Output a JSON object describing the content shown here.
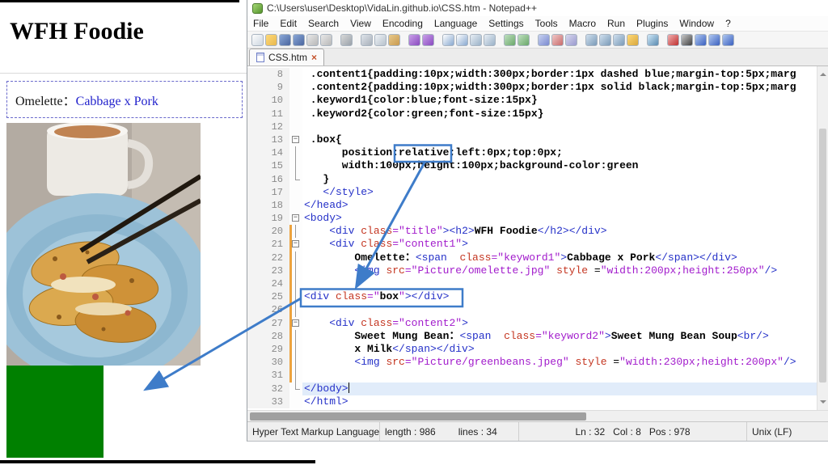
{
  "colors": {
    "annotation_blue": "#3e7cc9",
    "green_box": "#008000",
    "keyword_blue": "#2222cc"
  },
  "browser": {
    "page_title": "WFH Foodie",
    "content1": {
      "label": "Omelette：",
      "keyword": "Cabbage x Pork"
    }
  },
  "notepad": {
    "window_title": "C:\\Users\\user\\Desktop\\VidaLin.github.io\\CSS.htm - Notepad++",
    "menus": [
      "File",
      "Edit",
      "Search",
      "View",
      "Encoding",
      "Language",
      "Settings",
      "Tools",
      "Macro",
      "Run",
      "Plugins",
      "Window",
      "?"
    ],
    "toolbar_icons": [
      {
        "name": "new-file",
        "c1": "#fdfdfd",
        "c2": "#cdd6e0"
      },
      {
        "name": "open-folder",
        "c1": "#ffd978",
        "c2": "#e8b84e"
      },
      {
        "name": "save",
        "c1": "#8aa7d6",
        "c2": "#4a66a0"
      },
      {
        "name": "save-all",
        "c1": "#8aa7d6",
        "c2": "#4a66a0"
      },
      {
        "name": "close",
        "c1": "#e8e8e8",
        "c2": "#b8b8b8"
      },
      {
        "name": "close-all",
        "c1": "#e8e8e8",
        "c2": "#b8b8b8"
      },
      {
        "name": "print",
        "c1": "#d8d8d8",
        "c2": "#9aa2aa",
        "sep": true
      },
      {
        "name": "cut",
        "c1": "#dfe4ea",
        "c2": "#a8b0ba",
        "sep": true
      },
      {
        "name": "copy",
        "c1": "#eef2f6",
        "c2": "#b8c2cc"
      },
      {
        "name": "paste",
        "c1": "#e8c98a",
        "c2": "#c89a50"
      },
      {
        "name": "undo",
        "c1": "#c9a0e8",
        "c2": "#8a4ac0",
        "sep": true
      },
      {
        "name": "redo",
        "c1": "#c9a0e8",
        "c2": "#8a4ac0"
      },
      {
        "name": "find",
        "c1": "#ffffff",
        "c2": "#88a8d0",
        "sep": true
      },
      {
        "name": "replace",
        "c1": "#ffffff",
        "c2": "#88a8d0"
      },
      {
        "name": "zoom-in",
        "c1": "#e8eef4",
        "c2": "#9ab2c8"
      },
      {
        "name": "zoom-out",
        "c1": "#e8eef4",
        "c2": "#9ab2c8"
      },
      {
        "name": "sync-vertical",
        "c1": "#bfe0bf",
        "c2": "#6aa86a",
        "sep": true
      },
      {
        "name": "sync-horizontal",
        "c1": "#bfe0bf",
        "c2": "#6aa86a"
      },
      {
        "name": "word-wrap",
        "c1": "#c8d2f0",
        "c2": "#7a8ad0",
        "sep": true
      },
      {
        "name": "show-all-characters",
        "c1": "#f0c8c8",
        "c2": "#c86a6a"
      },
      {
        "name": "indent-guide",
        "c1": "#d8d8ee",
        "c2": "#9a9ace"
      },
      {
        "name": "function-list",
        "c1": "#d0e0ee",
        "c2": "#7a9ab8",
        "sep": true
      },
      {
        "name": "document-map",
        "c1": "#d0e0ee",
        "c2": "#7a9ab8"
      },
      {
        "name": "document-list",
        "c1": "#d0e0ee",
        "c2": "#7a9ab8"
      },
      {
        "name": "folder-as-workspace",
        "c1": "#ffd978",
        "c2": "#d8a83e"
      },
      {
        "name": "monitoring",
        "c1": "#cfe8f8",
        "c2": "#5a8ab0",
        "sep": true
      },
      {
        "name": "record-macro",
        "c1": "#f0b0b0",
        "c2": "#c03030",
        "sep": true
      },
      {
        "name": "stop-macro",
        "c1": "#c8c8c8",
        "c2": "#404040"
      },
      {
        "name": "play-macro",
        "c1": "#b0c8f0",
        "c2": "#3a60c0"
      },
      {
        "name": "save-macro",
        "c1": "#b0c8f0",
        "c2": "#3a60c0"
      },
      {
        "name": "run-macro-multiple",
        "c1": "#b0c8f0",
        "c2": "#3a60c0"
      }
    ],
    "tab": {
      "label": "CSS.htm",
      "close_glyph": "×"
    },
    "editor": {
      "lines": [
        {
          "num": 8,
          "tokens": [
            {
              "t": " .content1{padding:10px;width:300px;border:1px dashed blue;margin-top:5px;marg",
              "c": "css"
            }
          ]
        },
        {
          "num": 9,
          "tokens": [
            {
              "t": " .content2{padding:10px;width:300px;border:1px solid black;margin-top:5px;marg",
              "c": "css"
            }
          ]
        },
        {
          "num": 10,
          "tokens": [
            {
              "t": " .keyword1{color:blue;font-size:15px}",
              "c": "css"
            }
          ]
        },
        {
          "num": 11,
          "tokens": [
            {
              "t": " .keyword2{color:green;font-size:15px}",
              "c": "css"
            }
          ]
        },
        {
          "num": 12,
          "tokens": []
        },
        {
          "num": 13,
          "fold": "minus",
          "tokens": [
            {
              "t": " .box{",
              "c": "css"
            }
          ]
        },
        {
          "num": 14,
          "fold": "line",
          "tokens": [
            {
              "t": "      position:relative;left:0px;top:0px;",
              "c": "css"
            }
          ]
        },
        {
          "num": 15,
          "fold": "line",
          "tokens": [
            {
              "t": "      width:100px;height:100px;background-color:green",
              "c": "css"
            }
          ]
        },
        {
          "num": 16,
          "fold": "end",
          "tokens": [
            {
              "t": "   }",
              "c": "css"
            }
          ]
        },
        {
          "num": 17,
          "tokens": [
            {
              "t": "   </style>",
              "c": "tag"
            }
          ]
        },
        {
          "num": 18,
          "tokens": [
            {
              "t": "</head>",
              "c": "tag"
            }
          ]
        },
        {
          "num": 19,
          "fold": "minus",
          "tokens": [
            {
              "t": "<body>",
              "c": "tag"
            }
          ]
        },
        {
          "num": 20,
          "fold": "line",
          "chg": true,
          "tokens": [
            {
              "t": "    ",
              "c": "pln"
            },
            {
              "t": "<div ",
              "c": "tag"
            },
            {
              "t": "class",
              "c": "attr"
            },
            {
              "t": "=\"title\"",
              "c": "val"
            },
            {
              "t": "><h2>",
              "c": "tag"
            },
            {
              "t": "WFH Foodie",
              "c": "txt"
            },
            {
              "t": "</h2></div>",
              "c": "tag"
            }
          ]
        },
        {
          "num": 21,
          "fold": "minus",
          "chg": true,
          "tokens": [
            {
              "t": "    ",
              "c": "pln"
            },
            {
              "t": "<div ",
              "c": "tag"
            },
            {
              "t": "class",
              "c": "attr"
            },
            {
              "t": "=\"content1\"",
              "c": "val"
            },
            {
              "t": ">",
              "c": "tag"
            }
          ]
        },
        {
          "num": 22,
          "fold": "line",
          "chg": true,
          "tokens": [
            {
              "t": "        ",
              "c": "pln"
            },
            {
              "t": "Omelette：",
              "c": "txt"
            },
            {
              "t": "<span ",
              "c": "tag"
            },
            {
              "t": " class",
              "c": "attr"
            },
            {
              "t": "=\"keyword1\"",
              "c": "val"
            },
            {
              "t": ">",
              "c": "tag"
            },
            {
              "t": "Cabbage x Pork",
              "c": "txt"
            },
            {
              "t": "</span></div>",
              "c": "tag"
            }
          ]
        },
        {
          "num": 23,
          "fold": "line",
          "chg": true,
          "tokens": [
            {
              "t": "        ",
              "c": "pln"
            },
            {
              "t": "<img ",
              "c": "tag"
            },
            {
              "t": "src",
              "c": "attr"
            },
            {
              "t": "=\"Picture/omelette.jpg\"",
              "c": "val"
            },
            {
              "t": " style ",
              "c": "attr"
            },
            {
              "t": "=",
              "c": "pln"
            },
            {
              "t": "\"width:200px;height:250px\"",
              "c": "val"
            },
            {
              "t": "/>",
              "c": "tag"
            }
          ]
        },
        {
          "num": 24,
          "fold": "line",
          "chg": true,
          "tokens": []
        },
        {
          "num": 25,
          "fold": "line",
          "chg": true,
          "tokens": [
            {
              "t": "<div ",
              "c": "tag"
            },
            {
              "t": "class",
              "c": "attr"
            },
            {
              "t": "=\"",
              "c": "val"
            },
            {
              "t": "box",
              "c": "txt"
            },
            {
              "t": "\"",
              "c": "val"
            },
            {
              "t": "></div>",
              "c": "tag"
            }
          ]
        },
        {
          "num": 26,
          "fold": "line",
          "chg": true,
          "tokens": []
        },
        {
          "num": 27,
          "fold": "minus",
          "chg": true,
          "tokens": [
            {
              "t": "    ",
              "c": "pln"
            },
            {
              "t": "<div ",
              "c": "tag"
            },
            {
              "t": "class",
              "c": "attr"
            },
            {
              "t": "=\"content2\"",
              "c": "val"
            },
            {
              "t": ">",
              "c": "tag"
            }
          ]
        },
        {
          "num": 28,
          "fold": "line",
          "chg": true,
          "tokens": [
            {
              "t": "        ",
              "c": "pln"
            },
            {
              "t": "Sweet Mung Bean：",
              "c": "txt"
            },
            {
              "t": "<span ",
              "c": "tag"
            },
            {
              "t": " class",
              "c": "attr"
            },
            {
              "t": "=\"keyword2\"",
              "c": "val"
            },
            {
              "t": ">",
              "c": "tag"
            },
            {
              "t": "Sweet Mung Bean Soup",
              "c": "txt"
            },
            {
              "t": "<br/>",
              "c": "tag"
            }
          ]
        },
        {
          "num": 29,
          "fold": "line",
          "chg": true,
          "tokens": [
            {
              "t": "        ",
              "c": "pln"
            },
            {
              "t": "x Milk",
              "c": "txt"
            },
            {
              "t": "</span></div>",
              "c": "tag"
            }
          ]
        },
        {
          "num": 30,
          "fold": "line",
          "chg": true,
          "tokens": [
            {
              "t": "        ",
              "c": "pln"
            },
            {
              "t": "<img ",
              "c": "tag"
            },
            {
              "t": "src",
              "c": "attr"
            },
            {
              "t": "=\"Picture/greenbeans.jpeg\"",
              "c": "val"
            },
            {
              "t": " style ",
              "c": "attr"
            },
            {
              "t": "=",
              "c": "pln"
            },
            {
              "t": "\"width:230px;height:200px\"",
              "c": "val"
            },
            {
              "t": "/>",
              "c": "tag"
            }
          ]
        },
        {
          "num": 31,
          "fold": "line",
          "chg": true,
          "tokens": []
        },
        {
          "num": 32,
          "fold": "end",
          "cur": true,
          "caret": true,
          "tokens": [
            {
              "t": "</body>",
              "c": "tag"
            }
          ]
        },
        {
          "num": 33,
          "tokens": [
            {
              "t": "</html>",
              "c": "tag"
            }
          ]
        }
      ]
    },
    "status_bar": {
      "doc_type": "Hyper Text Markup Language file",
      "length": "length : 986",
      "lines": "lines : 34",
      "caret": "Ln : 32   Col : 8   Pos : 978",
      "eol": "Unix (LF)"
    }
  }
}
